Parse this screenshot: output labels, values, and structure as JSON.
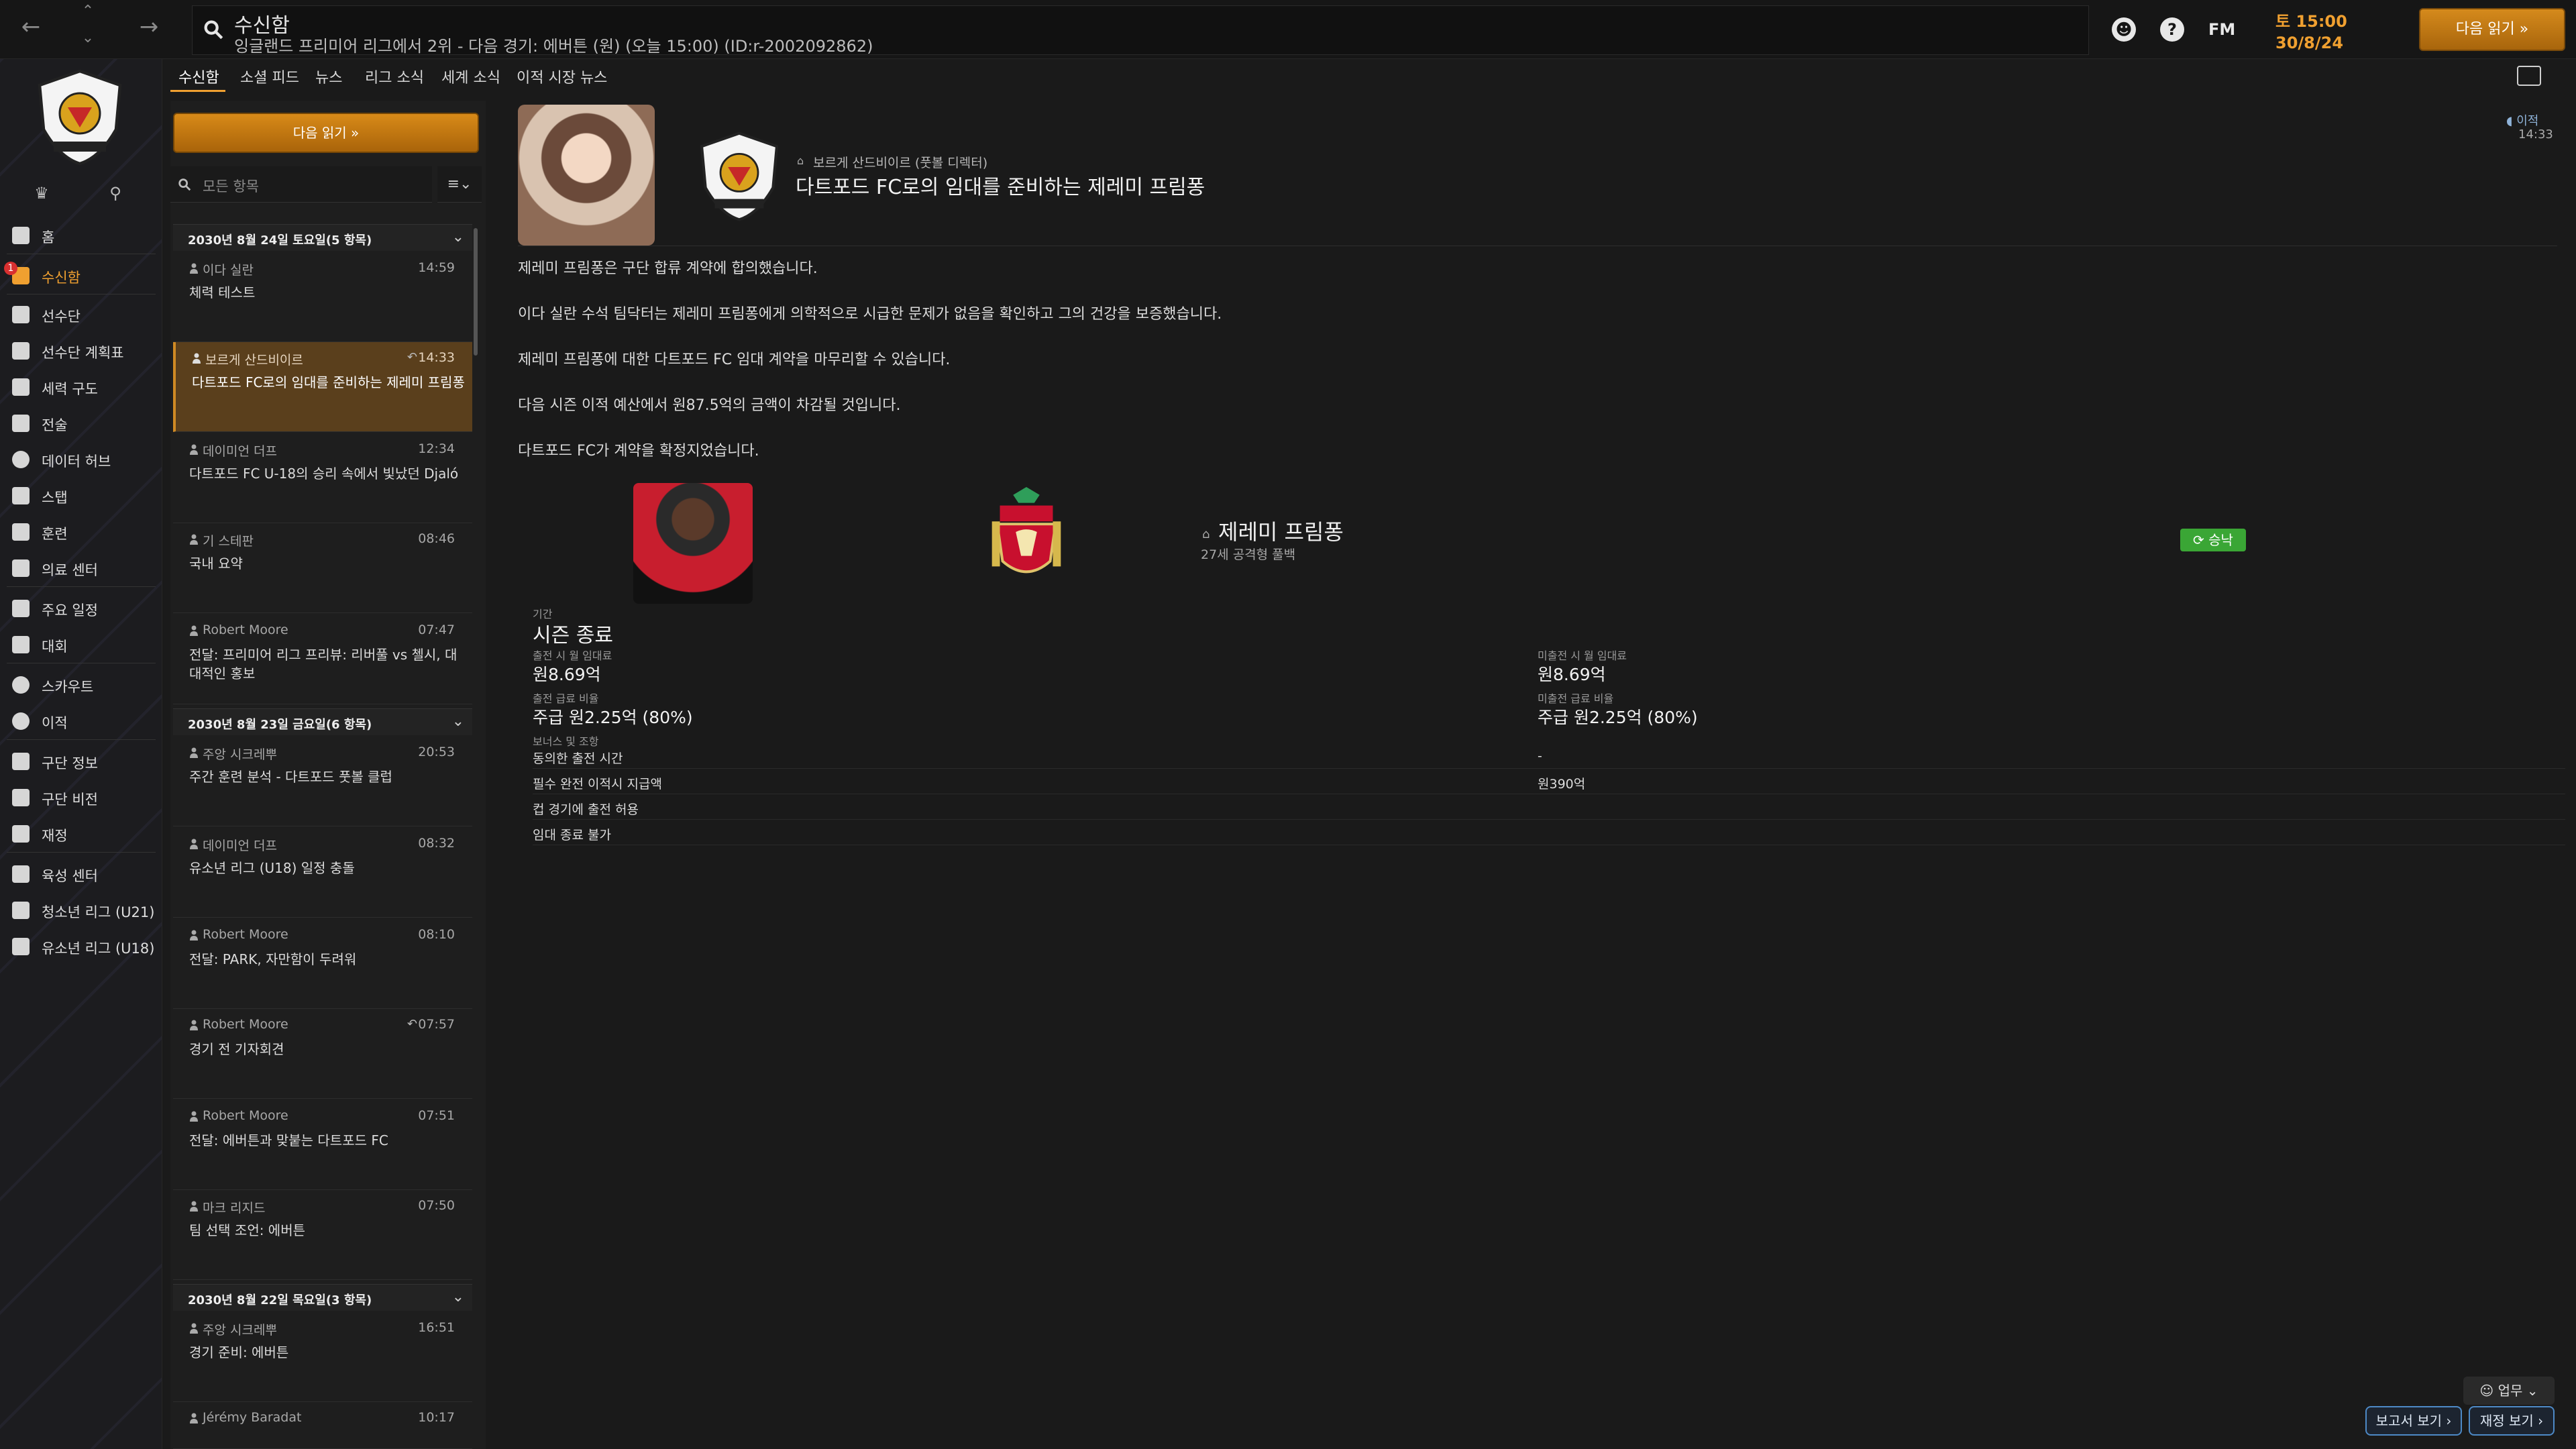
{
  "topbar": {
    "title": "수신함",
    "subtitle": "잉글랜드 프리미어 리그에서 2위 - 다음 경기: 에버튼 (원) (오늘 15:00) (ID:r-2002092862)",
    "fm_logo": "FM",
    "day_time": "토 15:00",
    "date": "30/8/24",
    "continue_label": "다음 읽기 »",
    "help_glyph": "?"
  },
  "sidebar": {
    "inbox_badge": "1",
    "items": [
      {
        "label": "홈"
      },
      {
        "label": "수신함"
      },
      {
        "label": "선수단"
      },
      {
        "label": "선수단 계획표"
      },
      {
        "label": "세력 구도"
      },
      {
        "label": "전술"
      },
      {
        "label": "데이터 허브"
      },
      {
        "label": "스탭"
      },
      {
        "label": "훈련"
      },
      {
        "label": "의료 센터"
      },
      {
        "label": "주요 일정"
      },
      {
        "label": "대회"
      },
      {
        "label": "스카우트"
      },
      {
        "label": "이적"
      },
      {
        "label": "구단 정보"
      },
      {
        "label": "구단 비전"
      },
      {
        "label": "재정"
      },
      {
        "label": "육성 센터"
      },
      {
        "label": "청소년 리그 (U21)"
      },
      {
        "label": "유소년 리그 (U18)"
      }
    ]
  },
  "tabs": [
    "수신함",
    "소셜 피드",
    "뉴스",
    "리그 소식",
    "세계 소식",
    "이적 시장 뉴스"
  ],
  "list": {
    "continue_label": "다음 읽기 »",
    "filter_placeholder": "모든 항목",
    "sort_glyph": "≡⌄",
    "groups": [
      {
        "label": "2030년 8월 24일 토요일(5 항목)"
      },
      {
        "label": "2030년 8월 23일 금요일(6 항목)"
      },
      {
        "label": "2030년 8월 22일 목요일(3 항목)"
      }
    ],
    "messages": [
      {
        "sender": "이다 실란",
        "time": "14:59",
        "subject": "체력 테스트"
      },
      {
        "sender": "보르게 산드비이르",
        "time": "14:33",
        "subject": "다트포드 FC로의 임대를 준비하는 제레미 프림퐁"
      },
      {
        "sender": "데이미언 더프",
        "time": "12:34",
        "subject": "다트포드 FC U-18의 승리 속에서 빛났던 Djaló"
      },
      {
        "sender": "기 스테판",
        "time": "08:46",
        "subject": "국내 요약"
      },
      {
        "sender": "Robert Moore",
        "time": "07:47",
        "subject": "전달: 프리미어 리그 프리뷰: 리버풀 vs 첼시, 대대적인 홍보"
      },
      {
        "sender": "주앙 시크레뿌",
        "time": "20:53",
        "subject": "주간 훈련 분석 - 다트포드 풋볼 클럽"
      },
      {
        "sender": "데이미언 더프",
        "time": "08:32",
        "subject": "유소년 리그 (U18) 일정 충돌"
      },
      {
        "sender": "Robert Moore",
        "time": "08:10",
        "subject": "전달: PARK, 자만함이 두려워"
      },
      {
        "sender": "Robert Moore",
        "time": "07:57",
        "subject": "경기 전 기자회견"
      },
      {
        "sender": "Robert Moore",
        "time": "07:51",
        "subject": "전달: 에버튼과 맞붙는 다트포드 FC"
      },
      {
        "sender": "마크 리지드",
        "time": "07:50",
        "subject": "팀 선택 조언: 에버튼"
      },
      {
        "sender": "주앙 시크레뿌",
        "time": "16:51",
        "subject": "경기 준비: 에버튼"
      },
      {
        "sender": "Jérémy Baradat",
        "time": "10:17",
        "subject": ""
      }
    ]
  },
  "message": {
    "from": "보르게 산드비이르 (풋볼 디렉터)",
    "title": "다트포드 FC로의 임대를 준비하는 제레미 프림퐁",
    "tag": "이적",
    "time": "14:33",
    "paragraphs": [
      "제레미 프림퐁은 구단 합류 계약에 합의했습니다.",
      "이다 실란 수석 팀닥터는 제레미 프림퐁에게 의학적으로 시급한 문제가 없음을 확인하고 그의 건강을 보증했습니다.",
      "제레미 프림퐁에 대한 다트포드 FC 임대 계약을 마무리할 수 있습니다.",
      "다음 시즌 이적 예산에서 원87.5억의 금액이 차감될 것입니다.",
      "다트포드 FC가 계약을 확정지었습니다."
    ],
    "player": {
      "name": "제레미 프림퐁",
      "desc": "27세 공격형 풀백",
      "status": "승낙"
    },
    "contract": {
      "period_label": "기간",
      "period_value": "시즌 종료",
      "fee_played_label": "출전 시 월 임대료",
      "fee_played": "원8.69억",
      "fee_unplayed_label": "미출전 시 월 임대료",
      "fee_unplayed": "원8.69억",
      "wage_played_label": "출전 급료 비율",
      "wage_played": "주급 원2.25억 (80%)",
      "wage_unplayed_label": "미출전 급료 비율",
      "wage_unplayed": "주급 원2.25억 (80%)",
      "clauses_label": "보너스 및 조항",
      "clauses": [
        {
          "name": "동의한 출전 시간",
          "value": "-"
        },
        {
          "name": "필수 완전 이적시 지급액",
          "value": "원390억"
        },
        {
          "name": "컵 경기에 출전 허용",
          "value": ""
        },
        {
          "name": "임대 종료 불가",
          "value": ""
        }
      ]
    }
  },
  "bottom": {
    "role_label": "업무",
    "report_label": "보고서 보기 ›",
    "finance_label": "재정 보기 ›"
  },
  "colors": {
    "accent": "#f0a030",
    "approved": "#3aa635",
    "selected_bg": "#5a3f1c"
  }
}
